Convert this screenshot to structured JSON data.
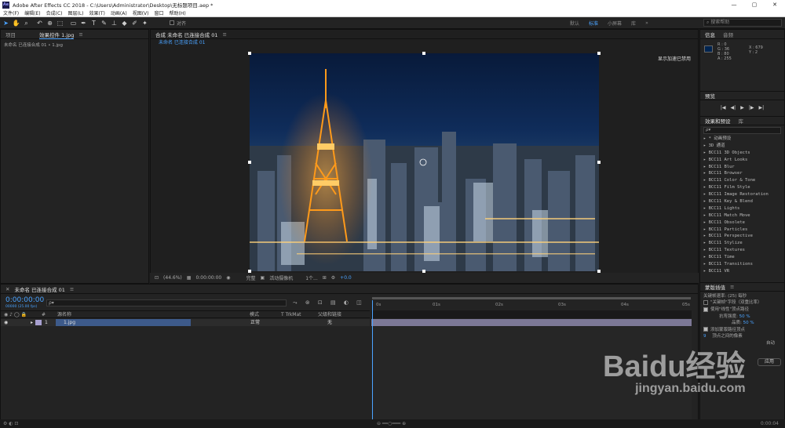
{
  "window": {
    "title": "Adobe After Effects CC 2018 - C:\\Users\\Administrator\\Desktop\\无标题项目.aep *",
    "logo": "Ae",
    "controls": [
      "—",
      "▢",
      "✕"
    ]
  },
  "menu": [
    "文件(F)",
    "编辑(E)",
    "合成(C)",
    "图层(L)",
    "效果(T)",
    "动画(A)",
    "视图(V)",
    "窗口",
    "帮助(H)"
  ],
  "toolbar": {
    "align_label": "对齐",
    "workspaces": [
      "默认",
      "标准",
      "小屏幕",
      "库"
    ],
    "active_workspace": "标准",
    "search_placeholder": "搜索帮助"
  },
  "project_panel": {
    "tabs": [
      "项目",
      "效果控件 1.jpg"
    ],
    "subtitle": "未命名 已连接合成 01 • 1.jpg"
  },
  "composition_panel": {
    "tab": "合成 未命名 已连接合成 01",
    "sub_tab": "未命名 已连接合成 01",
    "gpu_notice": "显示加速已禁用",
    "zoom": "(44.6%)",
    "timecode": "0:00:00:00",
    "resolution": "完整",
    "camera": "活动摄像机",
    "views": "1个...",
    "exposure": "+0.0"
  },
  "info_panel": {
    "tabs": [
      "信息",
      "音频"
    ],
    "r": "R : 0",
    "g": "G : 36",
    "b": "B : 80",
    "a": "A : 255",
    "x": "X : 679",
    "y": "Y : 2",
    "swatch_color": "#002450"
  },
  "preview_panel": {
    "title": "预览",
    "controls": [
      "|◀",
      "◀|",
      "▶",
      "|▶",
      "▶|"
    ]
  },
  "effects_panel": {
    "tabs": [
      "效果和预设",
      "库"
    ],
    "search_placeholder": "ρ▾",
    "items": [
      "* 动画预设",
      "3D 通道",
      "BCC11 3D Objects",
      "BCC11 Art Looks",
      "BCC11 Blur",
      "BCC11 Browser",
      "BCC11 Color & Tone",
      "BCC11 Film Style",
      "BCC11 Image Restoration",
      "BCC11 Key & Blend",
      "BCC11 Lights",
      "BCC11 Match Move",
      "BCC11 Obsolete",
      "BCC11 Particles",
      "BCC11 Perspective",
      "BCC11 Stylize",
      "BCC11 Textures",
      "BCC11 Time",
      "BCC11 Transitions",
      "BCC11 VR"
    ]
  },
  "smoother_panel": {
    "title": "蒙版插值",
    "keyframe_rate_label": "关键帧速率:",
    "keyframe_rate_value": "(25)",
    "keyframe_rate_unit": "每秒",
    "opt1": "\"关键帧\"字段（双重比率）",
    "opt2": "使用\"线性\"顶点路径",
    "stiffness_label": "抗弯强度:",
    "stiffness_value": "50 %",
    "quality_label": "品质:",
    "quality_value": "50 %",
    "add_vertices": "添加蒙版路径顶点",
    "vertices_value": "9",
    "vertices_mode": "顶点之间的像素",
    "auto_label": "自动",
    "apply_label": "应用"
  },
  "timeline": {
    "tab": "未命名 已连接合成 01",
    "timecode": "0:00:00:00",
    "fps": "00000 (25.00 fps)",
    "col_source": "源名称",
    "col_mode": "模式",
    "col_trkmat": "T TrkMat",
    "col_parent": "父级和链接",
    "layer_num": "1",
    "layer_name": "1.jpg",
    "layer_mode": "正常",
    "layer_parent": "无",
    "ruler": [
      "0s",
      "01s",
      "02s",
      "03s",
      "04s",
      "05s"
    ]
  },
  "status": {
    "right": "0:00:04"
  },
  "watermark": {
    "line1": "Baidu经验",
    "line2": "jingyan.baidu.com"
  }
}
